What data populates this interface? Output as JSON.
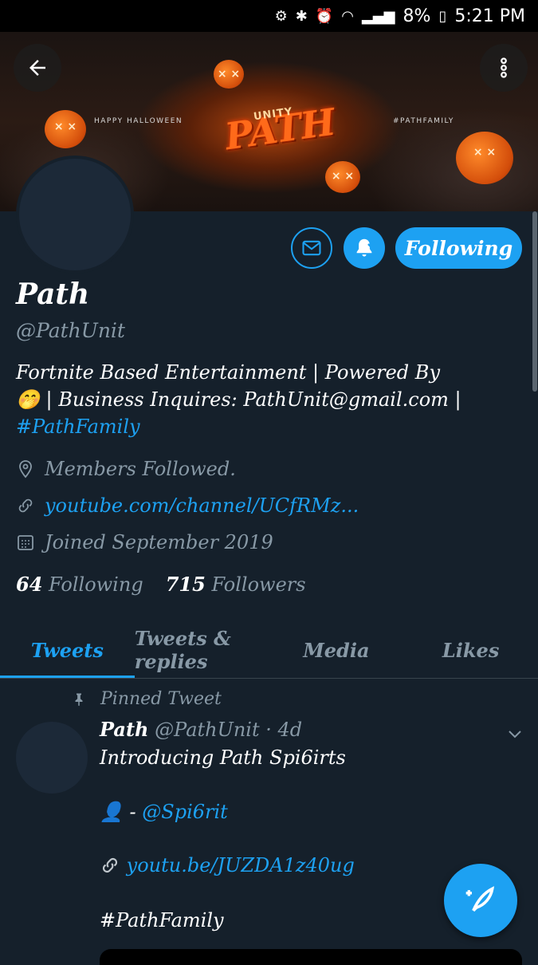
{
  "status_bar": {
    "battery": "8%",
    "time": "5:21 PM"
  },
  "banner": {
    "left_text": "HAPPY HALLOWEEN",
    "right_text": "#PATHFAMILY",
    "logo_text": "PATH",
    "logo_sub": "UNITY"
  },
  "profile": {
    "name": "Path",
    "handle": "@PathUnit",
    "bio_line1": "Fortnite Based Entertainment | Powered By",
    "bio_emoji": "🤭",
    "bio_line2": " | Business Inquires: PathUnit@gmail.com |",
    "bio_hashtag": "#PathFamily",
    "location": "Members Followed.",
    "website": "youtube.com/channel/UCfRMz...",
    "joined": "Joined September 2019",
    "following_count": "64",
    "following_label": "Following",
    "followers_count": "715",
    "followers_label": "Followers"
  },
  "actions": {
    "follow_button": "Following"
  },
  "tabs": [
    {
      "label": "Tweets"
    },
    {
      "label": "Tweets & replies"
    },
    {
      "label": "Media"
    },
    {
      "label": "Likes"
    }
  ],
  "tweet": {
    "pinned_label": "Pinned Tweet",
    "author_name": "Path",
    "author_handle": "@PathUnit",
    "time": "· 4d",
    "line1": "Introducing Path Spi6irts",
    "mention_prefix": "👤 -",
    "mention": "@Spi6rit",
    "link": "youtu.be/JUZDA1z40ug",
    "hashtag": "#PathFamily"
  },
  "colors": {
    "accent": "#1da1f2",
    "background": "#15202b",
    "secondary_text": "#8899a6"
  }
}
